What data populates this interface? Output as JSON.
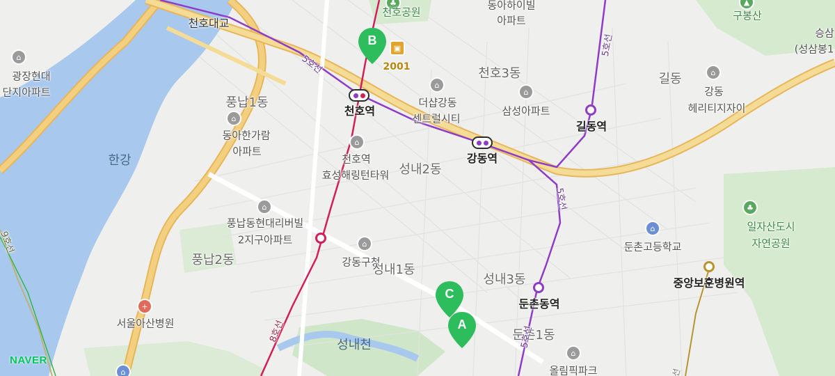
{
  "map": {
    "brand": "NAVER",
    "colors": {
      "water": "#a8c8ee",
      "park": "#cfe7c8",
      "expressway": "#f1c970",
      "line5": "#8e3cc8",
      "line8": "#d11f5c",
      "naver": "#03c75a",
      "marker": "#2ebd5c"
    },
    "labels": {
      "cheonho_bridge": "천호대교",
      "cheonho_park": "천호공원",
      "donga_highville_1": "동아하이빌",
      "donga_highville_2": "아파트",
      "gubongsan": "구봉산",
      "seungsam_1": "승삼",
      "seungsam_2": "(성삼봉1",
      "gwangjang_1": "광장현대",
      "gwangjang_2": "단지아파트",
      "cheonho3": "천호3동",
      "gildong": "길동",
      "gangdong_heritage_1": "강동",
      "gangdong_heritage_2": "헤리티지자이",
      "pungnap1": "풍납1동",
      "donga_hangaram_1": "동아한가람",
      "donga_hangaram_2": "아파트",
      "the_shop_1": "더샵강동",
      "the_shop_2": "센트럴시티",
      "samsung_apt": "삼성아파트",
      "hangang": "한강",
      "cheonho_hyosung_1": "천호역",
      "cheonho_hyosung_2": "효성해링턴타워",
      "seongnae2": "성내2동",
      "ilja_1": "일자산도시",
      "ilja_2": "자연공원",
      "pungnap_hyundai_1": "풍납동현대리버빌",
      "pungnap_hyundai_2": "2지구아파트",
      "dunchon_high": "둔촌고등학교",
      "pungnap2": "풍납2동",
      "gangdong_office": "강동구청",
      "seongnae1": "성내1동",
      "seongnae3": "성내3동",
      "asan_hospital": "서울아산병원",
      "seongnaecheon": "성내천",
      "dunchon1": "둔촌1동",
      "olympic_park": "올림픽파크",
      "brand_2001": "2001"
    },
    "stations": {
      "cheonho": "천호역",
      "gangdong": "강동역",
      "gildong": "길동역",
      "dunchon": "둔촌동역",
      "veterans": "중앙보훈병원역"
    },
    "lines": {
      "line5_a": "5호선",
      "line5_b": "5호선",
      "line5_c": "5호선",
      "line5_d": "5호선",
      "line8": "8호선",
      "line9": "9호선"
    },
    "markers": {
      "a": "A",
      "b": "B",
      "c": "C"
    },
    "icons": {
      "poi": "building-icon",
      "park": "tree-icon",
      "hospital": "hospital-icon",
      "school": "school-icon",
      "shopping": "shopping-cart-icon",
      "government": "government-icon",
      "marker": "map-pin-icon",
      "metro": "subway-icon"
    }
  }
}
